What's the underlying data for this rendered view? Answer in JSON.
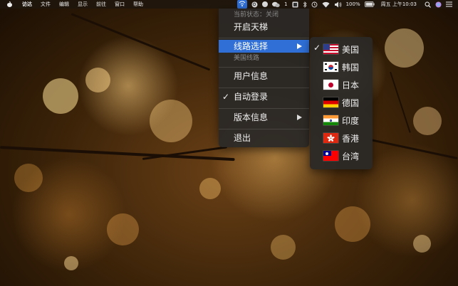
{
  "menubar": {
    "app_name": "访达",
    "items": [
      "文件",
      "编辑",
      "显示",
      "前往",
      "窗口",
      "帮助"
    ],
    "wechat_badge": "1",
    "battery": "100%",
    "datetime": "周五 上午10:03"
  },
  "menu": {
    "status_label": "当前状态：关闭",
    "toggle_label": "开启天梯",
    "route_select_label": "线路选择",
    "route_hint": "美国线路",
    "user_info_label": "用户信息",
    "auto_login_label": "自动登录",
    "version_label": "版本信息",
    "quit_label": "退出"
  },
  "submenu": {
    "regions": [
      {
        "label": "美国",
        "flag": "us-flag-icon",
        "checked": true
      },
      {
        "label": "韩国",
        "flag": "kr-flag-icon",
        "checked": false
      },
      {
        "label": "日本",
        "flag": "jp-flag-icon",
        "checked": false
      },
      {
        "label": "德国",
        "flag": "de-flag-icon",
        "checked": false
      },
      {
        "label": "印度",
        "flag": "in-flag-icon",
        "checked": false
      },
      {
        "label": "香港",
        "flag": "hk-flag-icon",
        "checked": false
      },
      {
        "label": "台湾",
        "flag": "tw-flag-icon",
        "checked": false
      }
    ]
  },
  "colors": {
    "highlight": "#2f6fd6",
    "menu_bg": "#2a2826"
  }
}
